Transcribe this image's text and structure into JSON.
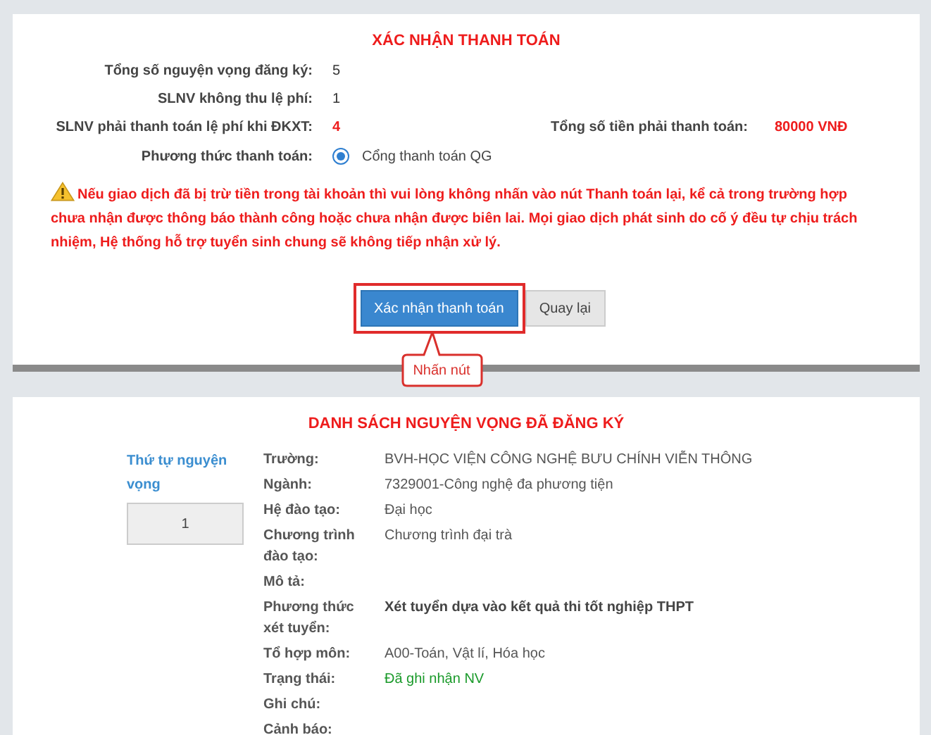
{
  "confirmation": {
    "title": "XÁC NHẬN THANH TOÁN",
    "fields": [
      {
        "label": "Tổng số nguyện vọng đăng ký:",
        "kind": "plain",
        "value": "5"
      },
      {
        "label": "SLNV không thu lệ phí:",
        "kind": "plain",
        "value": "1"
      },
      {
        "label": "SLNV phải thanh toán lệ phí khi ĐKXT:",
        "kind": "highlight",
        "value": "4",
        "side": {
          "label": "Tổng số tiền phải thanh toán:",
          "value": "80000 VNĐ"
        }
      },
      {
        "label": "Phương thức thanh toán:",
        "kind": "radio",
        "value": "Cổng thanh toán QG",
        "selected": true
      }
    ],
    "warning": "Nếu giao dịch đã bị trừ tiền trong tài khoản thì vui lòng không nhấn vào nút Thanh toán lại, kể cả trong trường hợp chưa nhận được thông báo thành công hoặc chưa nhận được biên lai. Mọi giao dịch phát sinh do cố ý đều tự chịu trách nhiệm, Hệ thống hỗ trợ tuyển sinh chung sẽ không tiếp nhận xử lý.",
    "buttons": [
      {
        "label": "Xác nhận thanh toán",
        "kind": "primary",
        "highlighted": true
      },
      {
        "label": "Quay lại",
        "kind": "secondary",
        "highlighted": false
      }
    ],
    "callout": {
      "text": "Nhấn nút"
    }
  },
  "registrations": {
    "title": "DANH SÁCH NGUYỆN VỌNG ĐÃ ĐĂNG KÝ",
    "order_label": "Thứ tự nguyện vọng",
    "order_value": "1",
    "details": [
      {
        "label": "Trường:",
        "value": "BVH-HỌC VIỆN CÔNG NGHỆ BƯU CHÍNH VIỄN THÔNG",
        "kind": "plain"
      },
      {
        "label": "Ngành:",
        "value": "7329001-Công nghệ đa phương tiện",
        "kind": "plain"
      },
      {
        "label": "Hệ đào tạo:",
        "value": "Đại học",
        "kind": "plain"
      },
      {
        "label": "Chương trình đào tạo:",
        "value": "Chương trình đại trà",
        "kind": "plain"
      },
      {
        "label": "Mô tả:"
      },
      {
        "label": "Phương thức xét tuyển:",
        "value": "Xét tuyển dựa vào kết quả thi tốt nghiệp THPT",
        "kind": "bold"
      },
      {
        "label": "Tổ hợp môn:",
        "value": "A00-Toán, Vật lí, Hóa học",
        "kind": "plain"
      },
      {
        "label": "Trạng thái:",
        "value": "Đã ghi nhận NV",
        "kind": "status"
      },
      {
        "label": "Ghi chú:"
      },
      {
        "label": "Cảnh báo:"
      }
    ]
  }
}
